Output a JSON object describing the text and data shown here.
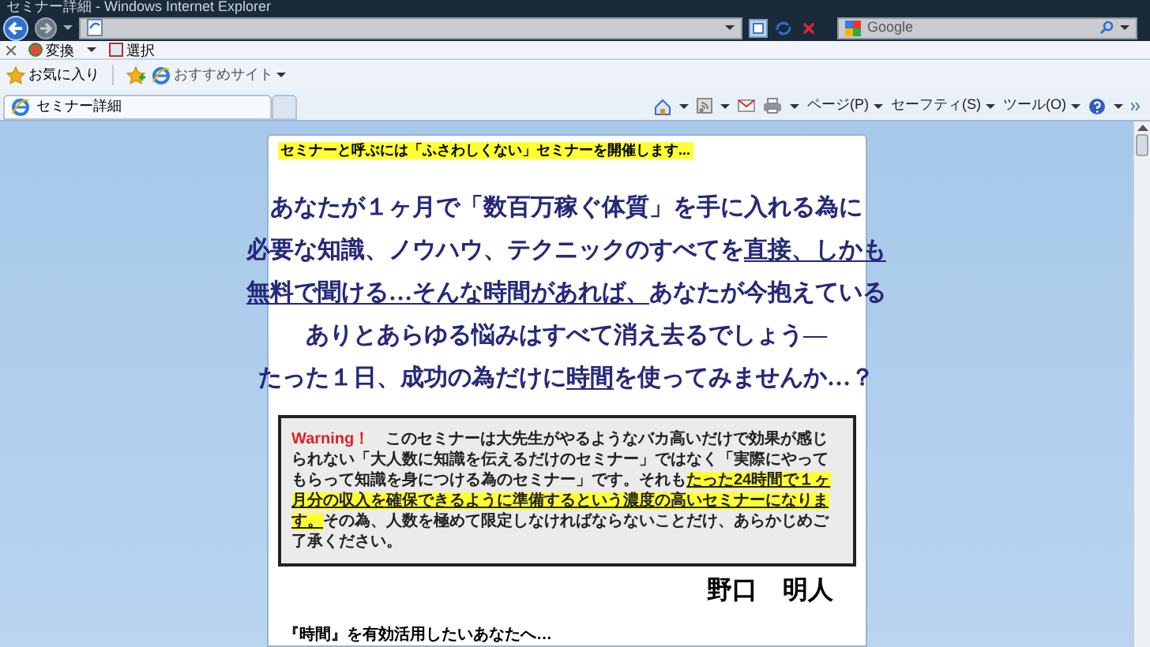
{
  "window": {
    "title": "セミナー詳細 - Windows Internet Explorer"
  },
  "search": {
    "placeholder": "Google"
  },
  "link_bar": [
    {
      "label": "変換",
      "dropdown": true
    },
    {
      "label": "選択",
      "dropdown": false
    }
  ],
  "favorites_bar": {
    "favorites": "お気に入り",
    "suggested": "おすすめサイト"
  },
  "tabs": [
    {
      "label": "セミナー詳細",
      "selected": true
    },
    {
      "selected": false
    }
  ],
  "command_bar": [
    "ページ(P)",
    "セーフティ(S)",
    "ツール(O)"
  ],
  "page": {
    "banner": "セミナーと呼ぶには「ふさわしくない」セミナーを開催します...",
    "headline": [
      [
        {
          "text": "あなたが１ヶ月で「数百万稼ぐ体質」を手に入れる為に",
          "underline": false
        }
      ],
      [
        {
          "text": "必要な知識、ノウハウ、テクニックのすべてを",
          "underline": false
        },
        {
          "text": "直接、しかも",
          "underline": true
        }
      ],
      [
        {
          "text": "無料で聞ける…そんな時間があれば、",
          "underline": true
        },
        {
          "text": "あなたが今抱えている",
          "underline": false
        }
      ],
      [
        {
          "text": "ありとあらゆる悩みはすべて消え去るでしょう―",
          "underline": false
        }
      ],
      [
        {
          "text": "たった１日、成功の為だけに",
          "underline": false
        },
        {
          "text": "時間",
          "underline": true
        },
        {
          "text": "を使ってみませんか…？",
          "underline": false
        }
      ]
    ],
    "warning": [
      {
        "kind": "label",
        "text": "Warning！"
      },
      {
        "kind": "plain",
        "text": "　このセミナーは大先生がやるようなバカ高いだけで効果が感じられない「大人数に知識を伝えるだけのセミナー」ではなく「実際にやってもらって知識を身につける為のセミナー」です。それも"
      },
      {
        "kind": "highlight",
        "text": "たった24時間で１ヶ月分の収入を確保できるように準備するという濃度の高いセミナーになります。"
      },
      {
        "kind": "plain",
        "text": "その為、人数を極めて限定しなければならないことだけ、あらかじめご了承ください。"
      }
    ],
    "signature": "野口　明人",
    "subheading": "『時間』を有効活用したいあなたへ…"
  }
}
